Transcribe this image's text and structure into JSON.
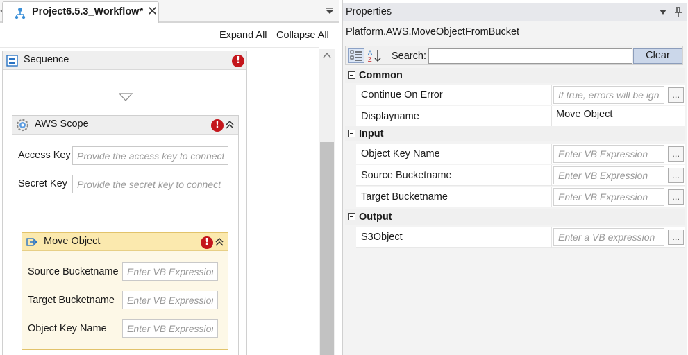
{
  "designer": {
    "tab": {
      "title": "Project6.5.3_Workflow*",
      "close_glyph": "✕",
      "icon": "workflow-icon"
    },
    "toolbar": {
      "expand_all": "Expand All",
      "collapse_all": "Collapse All"
    },
    "sequence": {
      "title": "Sequence",
      "error_glyph": "!",
      "aws_scope": {
        "title": "AWS Scope",
        "error_glyph": "!",
        "fields": [
          {
            "label": "Access Key",
            "placeholder": "Provide the access key to connect"
          },
          {
            "label": "Secret Key",
            "placeholder": "Provide the secret key to connect"
          }
        ],
        "move_object": {
          "title": "Move Object",
          "error_glyph": "!",
          "fields": [
            {
              "label": "Source Bucketname",
              "placeholder": "Enter VB Expression"
            },
            {
              "label": "Target Bucketname",
              "placeholder": "Enter VB Expression"
            },
            {
              "label": "Object Key Name",
              "placeholder": "Enter VB Expression"
            }
          ]
        }
      }
    }
  },
  "properties": {
    "panel_title": "Properties",
    "type_name": "Platform.AWS.MoveObjectFromBucket",
    "search": {
      "label": "Search:",
      "value": "",
      "clear_label": "Clear"
    },
    "ellipsis_label": "...",
    "categories": [
      {
        "name": "Common",
        "rows": [
          {
            "name": "Continue On Error",
            "placeholder": "If true, errors will be ignored",
            "value": "",
            "has_button": true
          },
          {
            "name": "Displayname",
            "placeholder": "",
            "value": "Move Object",
            "has_button": false
          }
        ]
      },
      {
        "name": "Input",
        "rows": [
          {
            "name": "Object Key Name",
            "placeholder": "Enter VB Expression",
            "value": "",
            "has_button": true
          },
          {
            "name": "Source Bucketname",
            "placeholder": "Enter VB Expression",
            "value": "",
            "has_button": true
          },
          {
            "name": "Target Bucketname",
            "placeholder": "Enter VB Expression",
            "value": "",
            "has_button": true
          }
        ]
      },
      {
        "name": "Output",
        "rows": [
          {
            "name": "S3Object",
            "placeholder": "Enter a VB expression",
            "value": "",
            "has_button": true
          }
        ]
      }
    ]
  },
  "colors": {
    "error_red": "#c4161c",
    "move_object_header": "#fbe9ae",
    "move_object_body": "#fdf8e7",
    "clear_button": "#cbd7ea"
  }
}
